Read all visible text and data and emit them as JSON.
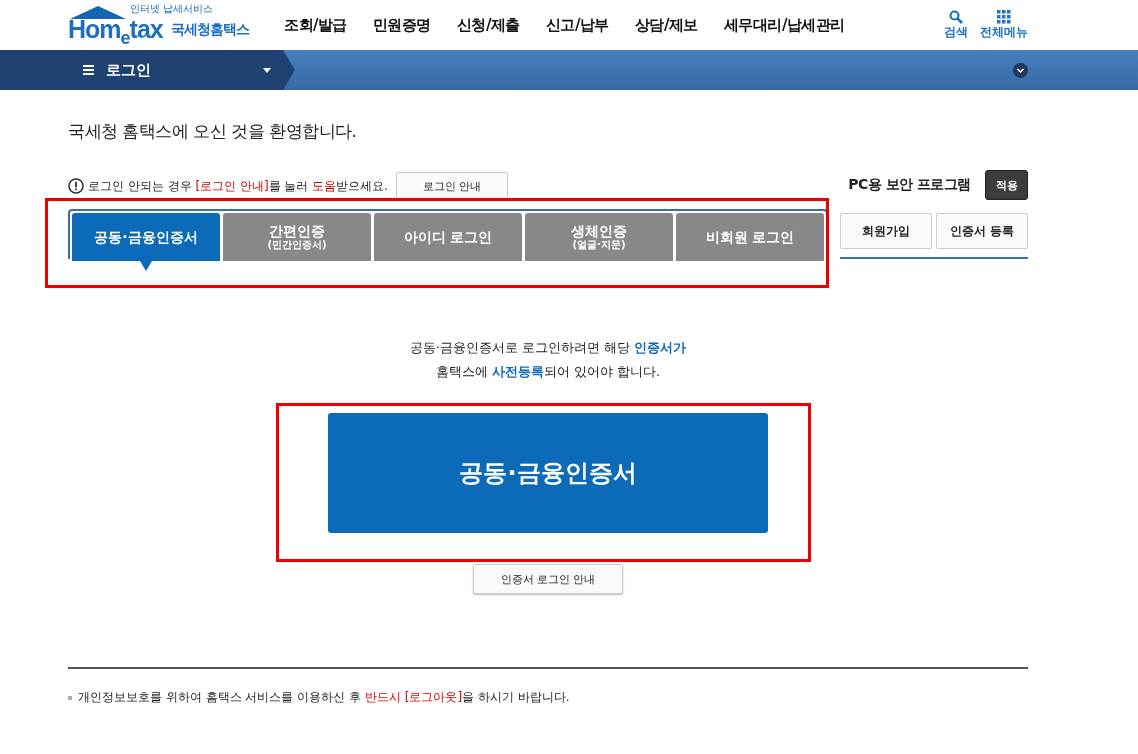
{
  "header": {
    "logo": {
      "tagline": "인터넷 납세서비스",
      "wordmark": "Hom$_{e}$tax",
      "name": "국세청홈택스"
    },
    "nav": [
      "조회/발급",
      "민원증명",
      "신청/제출",
      "신고/납부",
      "상담/제보",
      "세무대리/납세관리"
    ],
    "tools": [
      {
        "kind": "search",
        "label": "검색"
      },
      {
        "kind": "grid",
        "label": "전체메뉴"
      }
    ]
  },
  "breadcrumb": {
    "label": "로그인"
  },
  "welcome": "국세청 홈택스에 오신 것을 환영합니다.",
  "notice": {
    "segments": [
      {
        "text": "로그인 안되는 경우 ",
        "kind": "plain"
      },
      {
        "text": "[로그인 안내]",
        "kind": "alert"
      },
      {
        "text": "를 눌러 ",
        "kind": "plain"
      },
      {
        "text": "도움",
        "kind": "alert"
      },
      {
        "text": "받으세요.",
        "kind": "plain"
      }
    ],
    "button": "로그인 안내"
  },
  "security": {
    "label": "PC용 보안 프로그램",
    "button": "적용"
  },
  "tabs": [
    {
      "label": "공동·금융인증서",
      "selected": true
    },
    {
      "label": "간편인증",
      "sub": "(민간인증서)",
      "selected": false
    },
    {
      "label": "아이디 로그인",
      "selected": false
    },
    {
      "label": "생체인증",
      "sub": "(얼굴·지문)",
      "selected": false
    },
    {
      "label": "비회원 로그인",
      "selected": false
    }
  ],
  "side_buttons": [
    "회원가입",
    "인증서 등록"
  ],
  "instructions": [
    [
      {
        "text": "공동·금융인증서로 로그인하려면 해당 ",
        "kind": "plain"
      },
      {
        "text": "인증서가",
        "kind": "link"
      }
    ],
    [
      {
        "text": "홈택스에 ",
        "kind": "plain"
      },
      {
        "text": "사전등록",
        "kind": "link"
      },
      {
        "text": "되어 있어야 합니다.",
        "kind": "plain"
      }
    ]
  ],
  "main_button": "공동·금융인증서",
  "guide_button": "인증서 로그인 안내",
  "footer": [
    {
      "text": "개인정보보호를 위하여 홈택스 서비스를 이용하신 후 ",
      "kind": "plain"
    },
    {
      "text": "반드시 [로그아웃]",
      "kind": "alert"
    },
    {
      "text": "을 하시기 바랍니다.",
      "kind": "plain"
    }
  ],
  "tabs_highlighted": true,
  "main_button_highlighted": true
}
